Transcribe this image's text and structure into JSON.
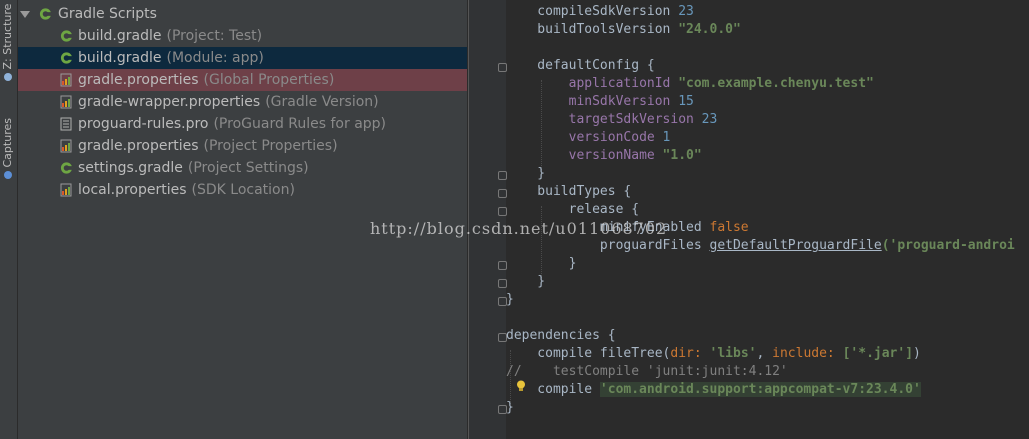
{
  "side_tabs": {
    "structure": "Z: Structure",
    "captures": "Captures"
  },
  "tree": {
    "root": "Gradle Scripts",
    "items": [
      {
        "name": "build.gradle",
        "hint": "(Project: Test)",
        "icon": "gradle-icon",
        "state": "normal"
      },
      {
        "name": "build.gradle",
        "hint": "(Module: app)",
        "icon": "gradle-icon",
        "state": "selected"
      },
      {
        "name": "gradle.properties",
        "hint": "(Global Properties)",
        "icon": "properties-icon",
        "state": "highlighted"
      },
      {
        "name": "gradle-wrapper.properties",
        "hint": "(Gradle Version)",
        "icon": "properties-icon",
        "state": "normal"
      },
      {
        "name": "proguard-rules.pro",
        "hint": "(ProGuard Rules for app)",
        "icon": "text-file-icon",
        "state": "normal"
      },
      {
        "name": "gradle.properties",
        "hint": "(Project Properties)",
        "icon": "properties-icon",
        "state": "normal"
      },
      {
        "name": "settings.gradle",
        "hint": "(Project Settings)",
        "icon": "gradle-icon",
        "state": "normal"
      },
      {
        "name": "local.properties",
        "hint": "(SDK Location)",
        "icon": "properties-icon",
        "state": "normal"
      }
    ]
  },
  "editor": {
    "l1": {
      "a": "    compileSdkVersion ",
      "b": "23"
    },
    "l2": {
      "a": "    buildToolsVersion ",
      "b": "\"24.0.0\""
    },
    "l4": "    defaultConfig {",
    "l5": {
      "a": "        ",
      "p": "applicationId",
      "s": " \"com.example.chenyu.test\""
    },
    "l6": {
      "a": "        ",
      "p": "minSdkVersion",
      "n": " 15"
    },
    "l7": {
      "a": "        ",
      "p": "targetSdkVersion",
      "n": " 23"
    },
    "l8": {
      "a": "        ",
      "p": "versionCode",
      "n": " 1"
    },
    "l9": {
      "a": "        ",
      "p": "versionName",
      "s": " \"1.0\""
    },
    "l10": "    }",
    "l11": "    buildTypes {",
    "l12": "        release {",
    "l13": {
      "a": "            minifyEnabled ",
      "k": "false"
    },
    "l14": {
      "a": "            proguardFiles ",
      "u": "getDefaultProguardFile",
      "s": "('proguard-androi"
    },
    "l15": "        }",
    "l16": "    }",
    "l17": "}",
    "l19": "dependencies {",
    "l20": {
      "a": "    compile fileTree(",
      "k1": "dir: ",
      "s1": "'libs'",
      "m": ", ",
      "k2": "include: ",
      "s2": "['*.jar']",
      "e": ")"
    },
    "l21": "//    testCompile 'junit:junit:4.12'",
    "l22": {
      "a": "    compile ",
      "s": "'com.android.support:appcompat-v7:23.4.0'"
    },
    "l23": "}"
  },
  "watermark": "http://blog.csdn.net/u011068702",
  "colors": {
    "tree_bg": "#3c3f41",
    "editor_bg": "#2b2b2b",
    "selected_row": "#0d293e",
    "highlighted_row": "#6e4048"
  }
}
